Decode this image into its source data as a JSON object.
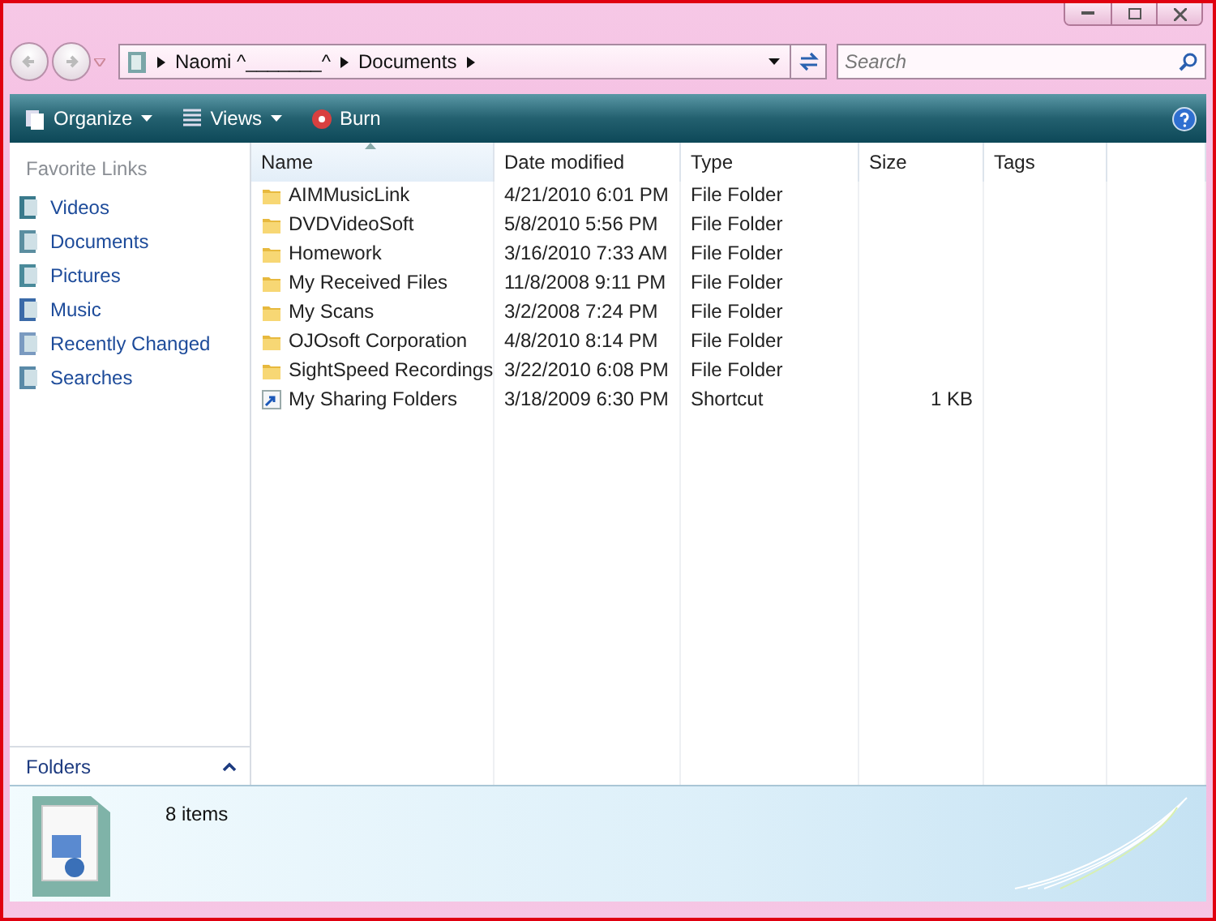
{
  "address_bar": {
    "segments": [
      "Naomi ^_______^",
      "Documents"
    ]
  },
  "search": {
    "placeholder": "Search"
  },
  "toolbar": {
    "buttons": [
      {
        "label": "Organize",
        "kind": "menu"
      },
      {
        "label": "Views",
        "kind": "menu"
      },
      {
        "label": "Burn",
        "kind": "plain"
      }
    ]
  },
  "sidebar": {
    "heading": "Favorite Links",
    "items": [
      {
        "label": "Videos"
      },
      {
        "label": "Documents"
      },
      {
        "label": "Pictures"
      },
      {
        "label": "Music"
      },
      {
        "label": "Recently Changed"
      },
      {
        "label": "Searches"
      }
    ],
    "folders_label": "Folders"
  },
  "table": {
    "columns": [
      "Name",
      "Date modified",
      "Type",
      "Size",
      "Tags"
    ],
    "rows": [
      {
        "kind": "folder",
        "cells": [
          "AIMMusicLink",
          "4/21/2010 6:01 PM",
          "File Folder"
        ]
      },
      {
        "kind": "folder",
        "cells": [
          "DVDVideoSoft",
          "5/8/2010 5:56 PM",
          "File Folder"
        ]
      },
      {
        "kind": "folder",
        "cells": [
          "Homework",
          "3/16/2010 7:33 AM",
          "File Folder"
        ]
      },
      {
        "kind": "folder",
        "cells": [
          "My Received Files",
          "11/8/2008 9:11 PM",
          "File Folder"
        ]
      },
      {
        "kind": "folder",
        "cells": [
          "My Scans",
          "3/2/2008 7:24 PM",
          "File Folder"
        ]
      },
      {
        "kind": "folder",
        "cells": [
          "OJOsoft Corporation",
          "4/8/2010 8:14 PM",
          "File Folder"
        ]
      },
      {
        "kind": "folder",
        "cells": [
          "SightSpeed Recordings",
          "3/22/2010 6:08 PM",
          "File Folder"
        ]
      },
      {
        "kind": "shortcut",
        "cells": [
          "My Sharing Folders",
          "3/18/2009 6:30 PM",
          "Shortcut",
          "1 KB"
        ]
      }
    ]
  },
  "details": {
    "count": "8 items"
  }
}
